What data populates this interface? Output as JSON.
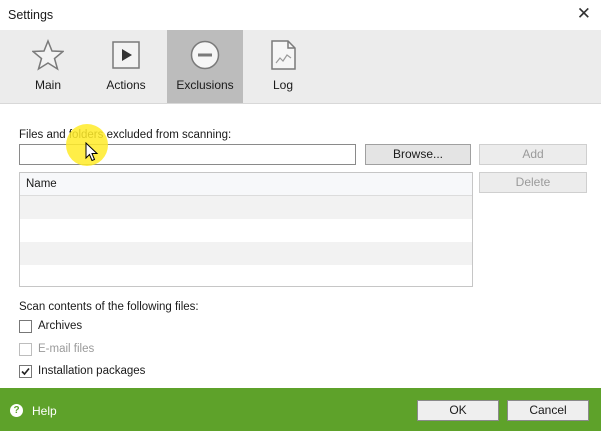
{
  "window": {
    "title": "Settings",
    "close_glyph": "✕"
  },
  "tabs": [
    {
      "label": "Main",
      "icon": "star-icon"
    },
    {
      "label": "Actions",
      "icon": "play-icon"
    },
    {
      "label": "Exclusions",
      "icon": "exclusion-icon",
      "active": true
    },
    {
      "label": "Log",
      "icon": "document-log-icon"
    }
  ],
  "exclusions": {
    "files_label": "Files and folders excluded from scanning:",
    "path_value": "",
    "browse_label": "Browse...",
    "add_label": "Add",
    "delete_label": "Delete",
    "list_column_name": "Name"
  },
  "scan": {
    "heading": "Scan contents of the following files:",
    "options": [
      {
        "label": "Archives",
        "checked": false,
        "enabled": true
      },
      {
        "label": "E-mail files",
        "checked": false,
        "enabled": false
      },
      {
        "label": "Installation packages",
        "checked": true,
        "enabled": true
      }
    ]
  },
  "footer": {
    "help_label": "Help",
    "help_glyph": "?",
    "ok_label": "OK",
    "cancel_label": "Cancel"
  },
  "colors": {
    "footer_green": "#5ea22a",
    "active_tab": "#bcbcbc",
    "toolbar_bg": "#ececec"
  }
}
